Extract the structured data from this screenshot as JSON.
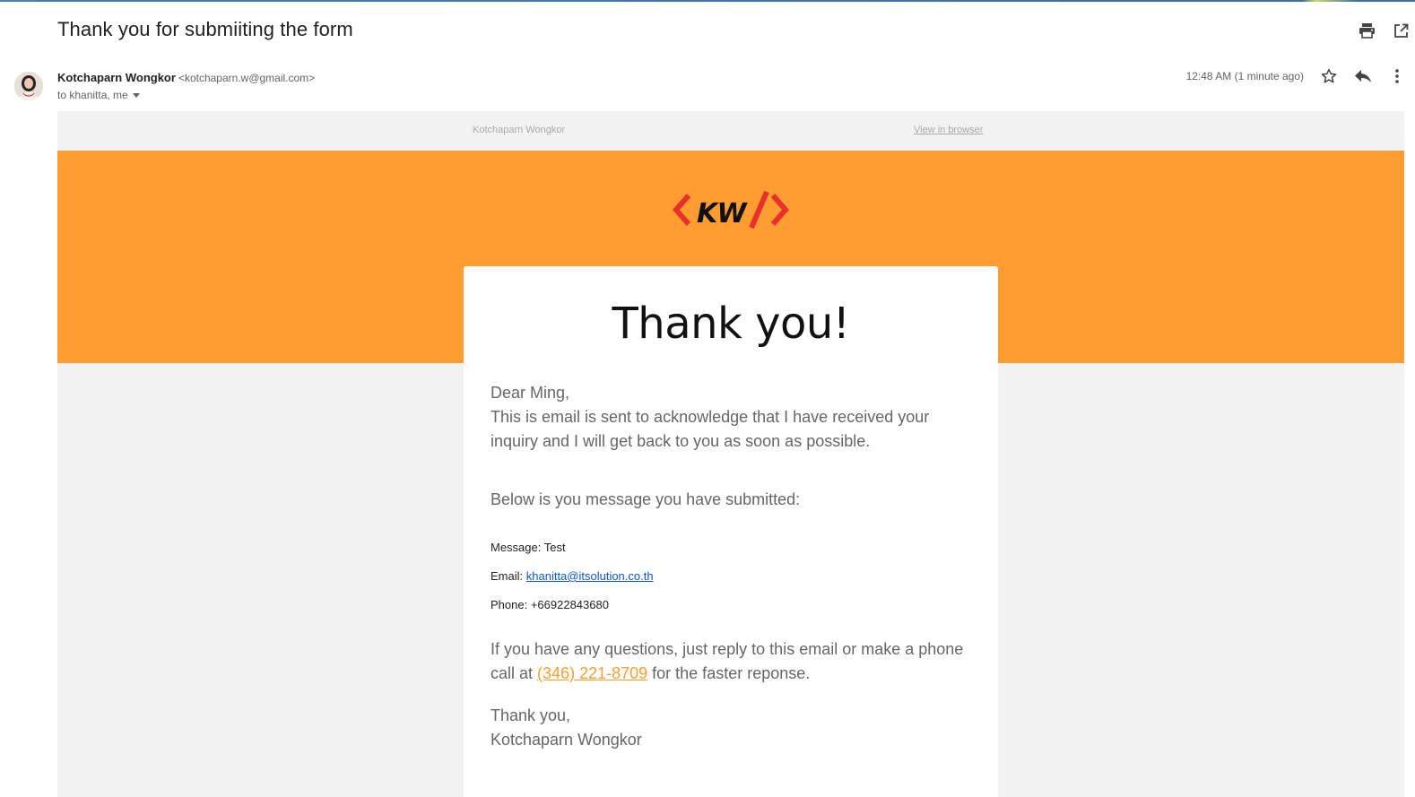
{
  "email": {
    "subject": "Thank you for submiiting the form",
    "sender_name": "Kotchaparn Wongkor",
    "sender_email": "<kotchaparn.w@gmail.com>",
    "recipients": "to khanitta, me",
    "timestamp": "12:48 AM (1 minute ago)"
  },
  "toolbar": {
    "icons": [
      "print-icon",
      "open-in-new-window-icon",
      "star-icon",
      "reply-icon",
      "more-vert-icon",
      "dropdown-caret-icon"
    ]
  },
  "body": {
    "preheader_name": "Kotchaparn Wongkor",
    "view_in_browser": "View in browser",
    "logo_text": "KW",
    "title": "Thank you!",
    "greeting": "Dear Ming,",
    "intro": "This is email is sent to acknowledge that I have received your inquiry and I will get back to you as soon as possible.",
    "submitted_heading": "Below is you message you have submitted:",
    "message_label": "Message:",
    "message_value": "Test",
    "email_label": "Email:",
    "email_value": "khanitta@itsolution.co.th",
    "phone_label": "Phone:",
    "phone_value": "+66922843680",
    "questions_before": "If you have any questions, just reply to this email or make a phone call at",
    "phone_link": "(346) 221-8709",
    "questions_after": "for the faster reponse.",
    "signoff": "Thank you,",
    "signature": "Kotchaparn Wongkor"
  },
  "colors": {
    "brand_orange": "#ff9d33",
    "logo_red": "#e8302a",
    "canvas_gray": "#f2f2f2",
    "link_blue": "#1155cc"
  }
}
